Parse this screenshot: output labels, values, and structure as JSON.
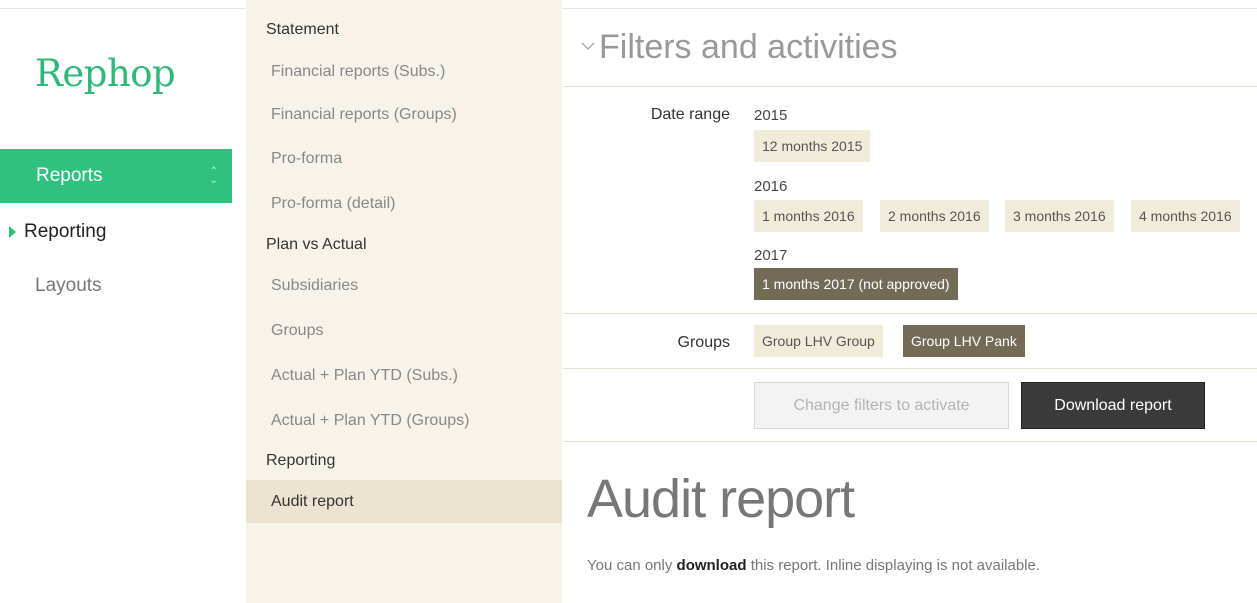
{
  "brand": {
    "logo_text": "Rephop",
    "accent_color": "#2ec27e"
  },
  "left_nav": {
    "reports_label": "Reports",
    "reports_icon": "sort-updown-icon",
    "reporting_label": "Reporting",
    "reporting_icon": "triangle-right-icon",
    "layouts_label": "Layouts"
  },
  "middle_menu": {
    "statement_header": "Statement",
    "fin_subs": "Financial reports (Subs.)",
    "fin_groups": "Financial reports (Groups)",
    "pro_forma": "Pro-forma",
    "pro_forma_detail": "Pro-forma (detail)",
    "plan_vs_actual_header": "Plan vs Actual",
    "subsidiaries": "Subsidiaries",
    "groups": "Groups",
    "actual_plan_subs": "Actual + Plan YTD (Subs.)",
    "actual_plan_groups": "Actual + Plan YTD (Groups)",
    "reporting_header": "Reporting",
    "audit_report": "Audit report"
  },
  "filters": {
    "title": "Filters and activities",
    "collapse_icon": "chevron-down-icon",
    "date_range_label": "Date range",
    "year_2015": "2015",
    "chip_2015_12": "12 months 2015",
    "year_2016": "2016",
    "chip_2016_1": "1 months 2016",
    "chip_2016_2": "2 months 2016",
    "chip_2016_3": "3 months 2016",
    "chip_2016_4": "4 months 2016",
    "year_2017": "2017",
    "chip_2017_1": "1 months 2017 (not approved)",
    "groups_label": "Groups",
    "group_lhv_group": "Group LHV Group",
    "group_lhv_pank": "Group LHV Pank",
    "change_filters_button": "Change filters to activate",
    "download_button": "Download report"
  },
  "report": {
    "title": "Audit report",
    "note_prefix": "You can only ",
    "note_bold": "download",
    "note_suffix": " this report. Inline displaying is not available."
  }
}
